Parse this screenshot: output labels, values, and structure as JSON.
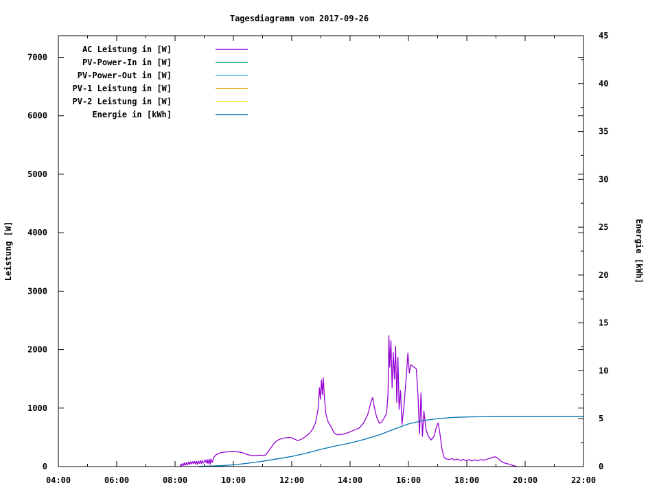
{
  "chart_data": {
    "type": "line",
    "title": "Tagesdiagramm vom 2017-09-26",
    "x_axis": {
      "unit": "time",
      "range_hours": [
        4,
        22
      ],
      "ticks": [
        {
          "h": 4,
          "label": "04:00"
        },
        {
          "h": 6,
          "label": "06:00"
        },
        {
          "h": 8,
          "label": "08:00"
        },
        {
          "h": 10,
          "label": "10:00"
        },
        {
          "h": 12,
          "label": "12:00"
        },
        {
          "h": 14,
          "label": "14:00"
        },
        {
          "h": 16,
          "label": "16:00"
        },
        {
          "h": 18,
          "label": "18:00"
        },
        {
          "h": 20,
          "label": "20:00"
        },
        {
          "h": 22,
          "label": "22:00"
        }
      ],
      "minor_hours": [
        5,
        7,
        9,
        11,
        13,
        15,
        17,
        19,
        21
      ]
    },
    "y_axis": {
      "label": "Leistung [W]",
      "min": 0,
      "max": 7370,
      "ticks": [
        {
          "v": 0,
          "label": "0"
        },
        {
          "v": 1000,
          "label": "1000"
        },
        {
          "v": 2000,
          "label": "2000"
        },
        {
          "v": 3000,
          "label": "3000"
        },
        {
          "v": 4000,
          "label": "4000"
        },
        {
          "v": 5000,
          "label": "5000"
        },
        {
          "v": 6000,
          "label": "6000"
        },
        {
          "v": 7000,
          "label": "7000"
        }
      ]
    },
    "y2_axis": {
      "label": "Energie [kWh]",
      "min": 0,
      "max": 45,
      "ticks": [
        {
          "v": 0,
          "label": "0"
        },
        {
          "v": 5,
          "label": "5"
        },
        {
          "v": 10,
          "label": "10"
        },
        {
          "v": 15,
          "label": "15"
        },
        {
          "v": 20,
          "label": "20"
        },
        {
          "v": 25,
          "label": "25"
        },
        {
          "v": 30,
          "label": "30"
        },
        {
          "v": 35,
          "label": "35"
        },
        {
          "v": 40,
          "label": "40"
        },
        {
          "v": 45,
          "label": "45"
        }
      ],
      "minor_values": [
        2.5,
        7.5,
        12.5,
        17.5,
        22.5,
        27.5,
        32.5,
        37.5,
        42.5
      ]
    },
    "legend_position": "top-left-inside",
    "grid": false,
    "series": [
      {
        "name": "AC Leistung in [W]",
        "color": "#9400d3",
        "axis": "y1",
        "points": [
          [
            8.17,
            0
          ],
          [
            8.2,
            40
          ],
          [
            8.23,
            12
          ],
          [
            8.27,
            55
          ],
          [
            8.3,
            20
          ],
          [
            8.33,
            65
          ],
          [
            8.37,
            25
          ],
          [
            8.4,
            70
          ],
          [
            8.43,
            30
          ],
          [
            8.47,
            75
          ],
          [
            8.5,
            35
          ],
          [
            8.53,
            80
          ],
          [
            8.57,
            45
          ],
          [
            8.6,
            85
          ],
          [
            8.63,
            50
          ],
          [
            8.67,
            88
          ],
          [
            8.7,
            42
          ],
          [
            8.73,
            92
          ],
          [
            8.77,
            38
          ],
          [
            8.8,
            95
          ],
          [
            8.83,
            55
          ],
          [
            8.87,
            100
          ],
          [
            8.9,
            48
          ],
          [
            8.93,
            105
          ],
          [
            8.97,
            60
          ],
          [
            9.0,
            85
          ],
          [
            9.03,
            115
          ],
          [
            9.07,
            65
          ],
          [
            9.1,
            120
          ],
          [
            9.13,
            50
          ],
          [
            9.17,
            125
          ],
          [
            9.2,
            38
          ],
          [
            9.23,
            130
          ],
          [
            9.27,
            70
          ],
          [
            9.3,
            110
          ],
          [
            9.33,
            160
          ],
          [
            9.4,
            200
          ],
          [
            9.5,
            225
          ],
          [
            9.65,
            245
          ],
          [
            9.8,
            252
          ],
          [
            10.0,
            256
          ],
          [
            10.15,
            252
          ],
          [
            10.3,
            238
          ],
          [
            10.45,
            210
          ],
          [
            10.6,
            190
          ],
          [
            10.75,
            186
          ],
          [
            10.9,
            196
          ],
          [
            11.0,
            190
          ],
          [
            11.1,
            198
          ],
          [
            11.2,
            260
          ],
          [
            11.3,
            330
          ],
          [
            11.4,
            400
          ],
          [
            11.5,
            445
          ],
          [
            11.6,
            470
          ],
          [
            11.75,
            488
          ],
          [
            11.9,
            496
          ],
          [
            12.0,
            490
          ],
          [
            12.1,
            468
          ],
          [
            12.2,
            445
          ],
          [
            12.3,
            460
          ],
          [
            12.45,
            505
          ],
          [
            12.6,
            565
          ],
          [
            12.72,
            640
          ],
          [
            12.82,
            760
          ],
          [
            12.9,
            980
          ],
          [
            12.95,
            1350
          ],
          [
            12.98,
            1150
          ],
          [
            13.02,
            1480
          ],
          [
            13.05,
            1230
          ],
          [
            13.08,
            1520
          ],
          [
            13.12,
            1180
          ],
          [
            13.17,
            900
          ],
          [
            13.25,
            760
          ],
          [
            13.35,
            680
          ],
          [
            13.45,
            580
          ],
          [
            13.55,
            545
          ],
          [
            13.7,
            548
          ],
          [
            13.85,
            565
          ],
          [
            14.0,
            595
          ],
          [
            14.15,
            625
          ],
          [
            14.3,
            655
          ],
          [
            14.45,
            735
          ],
          [
            14.6,
            880
          ],
          [
            14.7,
            1080
          ],
          [
            14.77,
            1180
          ],
          [
            14.83,
            1020
          ],
          [
            14.9,
            860
          ],
          [
            15.0,
            740
          ],
          [
            15.08,
            760
          ],
          [
            15.17,
            830
          ],
          [
            15.25,
            905
          ],
          [
            15.3,
            1250
          ],
          [
            15.33,
            2240
          ],
          [
            15.36,
            1700
          ],
          [
            15.4,
            2150
          ],
          [
            15.44,
            1350
          ],
          [
            15.48,
            1950
          ],
          [
            15.52,
            1500
          ],
          [
            15.56,
            2060
          ],
          [
            15.6,
            1100
          ],
          [
            15.64,
            1870
          ],
          [
            15.68,
            980
          ],
          [
            15.73,
            1300
          ],
          [
            15.78,
            720
          ],
          [
            15.85,
            1050
          ],
          [
            15.92,
            1500
          ],
          [
            15.98,
            1940
          ],
          [
            16.03,
            1600
          ],
          [
            16.08,
            1740
          ],
          [
            16.17,
            1710
          ],
          [
            16.27,
            1670
          ],
          [
            16.33,
            1200
          ],
          [
            16.38,
            560
          ],
          [
            16.43,
            1260
          ],
          [
            16.48,
            520
          ],
          [
            16.53,
            950
          ],
          [
            16.6,
            640
          ],
          [
            16.68,
            520
          ],
          [
            16.78,
            455
          ],
          [
            16.88,
            520
          ],
          [
            16.97,
            700
          ],
          [
            17.02,
            745
          ],
          [
            17.08,
            560
          ],
          [
            17.15,
            300
          ],
          [
            17.22,
            155
          ],
          [
            17.3,
            130
          ],
          [
            17.4,
            120
          ],
          [
            17.5,
            138
          ],
          [
            17.58,
            108
          ],
          [
            17.68,
            128
          ],
          [
            17.78,
            102
          ],
          [
            17.88,
            122
          ],
          [
            17.98,
            98
          ],
          [
            18.08,
            118
          ],
          [
            18.18,
            96
          ],
          [
            18.28,
            114
          ],
          [
            18.38,
            100
          ],
          [
            18.48,
            118
          ],
          [
            18.6,
            108
          ],
          [
            18.72,
            132
          ],
          [
            18.85,
            150
          ],
          [
            18.95,
            168
          ],
          [
            19.05,
            148
          ],
          [
            19.15,
            100
          ],
          [
            19.25,
            70
          ],
          [
            19.35,
            52
          ],
          [
            19.45,
            42
          ],
          [
            19.55,
            22
          ],
          [
            19.65,
            10
          ],
          [
            19.73,
            0
          ]
        ]
      },
      {
        "name": "PV-Power-In in [W]",
        "color": "#009e73",
        "axis": "y1",
        "points": [
          [
            8.85,
            0
          ],
          [
            9.3,
            0
          ]
        ]
      },
      {
        "name": "PV-Power-Out in [W]",
        "color": "#56b4e9",
        "axis": "y1",
        "points": [
          [
            8.85,
            0
          ],
          [
            9.95,
            0
          ]
        ]
      },
      {
        "name": "PV-1 Leistung in [W]",
        "color": "#e69f00",
        "axis": "y1",
        "points": []
      },
      {
        "name": "PV-2 Leistung in [W]",
        "color": "#f0e442",
        "axis": "y1",
        "points": []
      },
      {
        "name": "Energie in [kWh]",
        "color": "#0072b2",
        "axis": "y2",
        "points": [
          [
            8.8,
            0.02
          ],
          [
            9.2,
            0.05
          ],
          [
            9.6,
            0.1
          ],
          [
            10.0,
            0.18
          ],
          [
            10.5,
            0.35
          ],
          [
            11.0,
            0.55
          ],
          [
            11.5,
            0.8
          ],
          [
            12.0,
            1.05
          ],
          [
            12.5,
            1.4
          ],
          [
            13.0,
            1.8
          ],
          [
            13.5,
            2.15
          ],
          [
            14.0,
            2.45
          ],
          [
            14.5,
            2.85
          ],
          [
            15.0,
            3.3
          ],
          [
            15.5,
            3.9
          ],
          [
            16.0,
            4.45
          ],
          [
            16.5,
            4.8
          ],
          [
            17.0,
            5.0
          ],
          [
            17.5,
            5.12
          ],
          [
            18.0,
            5.18
          ],
          [
            18.5,
            5.2
          ],
          [
            19.0,
            5.22
          ],
          [
            20.0,
            5.22
          ],
          [
            22.0,
            5.22
          ]
        ]
      }
    ]
  }
}
